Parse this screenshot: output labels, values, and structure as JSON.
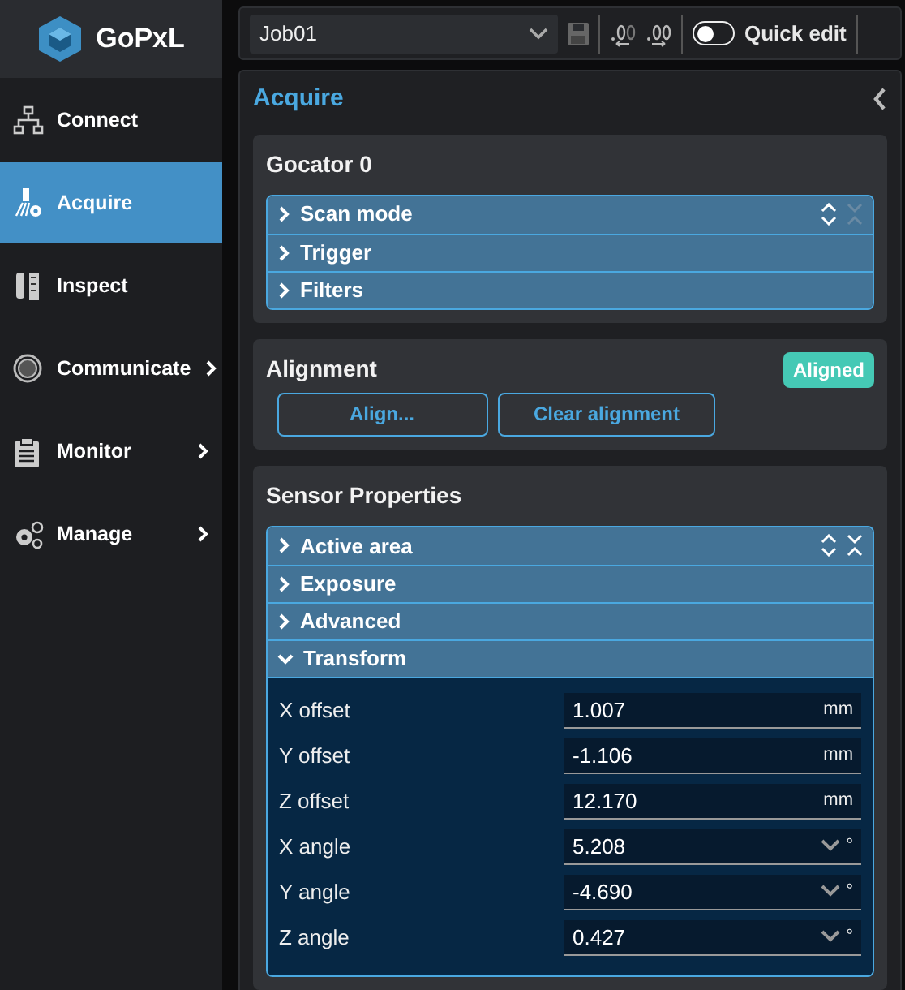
{
  "logo": {
    "text": "GoPxL"
  },
  "nav": [
    {
      "label": "Connect",
      "selected": false,
      "submenu": false
    },
    {
      "label": "Acquire",
      "selected": true,
      "submenu": false
    },
    {
      "label": "Inspect",
      "selected": false,
      "submenu": false
    },
    {
      "label": "Communicate",
      "selected": false,
      "submenu": true
    },
    {
      "label": "Monitor",
      "selected": false,
      "submenu": true
    },
    {
      "label": "Manage",
      "selected": false,
      "submenu": true
    }
  ],
  "toolbar": {
    "job": "Job01",
    "quick_edit": {
      "label": "Quick edit",
      "on": false
    }
  },
  "panel": {
    "title": "Acquire",
    "gocator": {
      "title": "Gocator 0",
      "collapse_all_disabled": true,
      "items": [
        {
          "label": "Scan mode",
          "expanded": false
        },
        {
          "label": "Trigger",
          "expanded": false
        },
        {
          "label": "Filters",
          "expanded": false
        }
      ]
    },
    "alignment": {
      "title": "Alignment",
      "status": "Aligned",
      "buttons": [
        "Align...",
        "Clear alignment"
      ]
    },
    "sensor": {
      "title": "Sensor Properties",
      "collapse_all_disabled": false,
      "items": [
        {
          "label": "Active area",
          "expanded": false
        },
        {
          "label": "Exposure",
          "expanded": false
        },
        {
          "label": "Advanced",
          "expanded": false
        },
        {
          "label": "Transform",
          "expanded": true
        }
      ],
      "transform": [
        {
          "label": "X offset",
          "value": "1.007",
          "unit": "mm",
          "kind": "number"
        },
        {
          "label": "Y offset",
          "value": "-1.106",
          "unit": "mm",
          "kind": "number"
        },
        {
          "label": "Z offset",
          "value": "12.170",
          "unit": "mm",
          "kind": "number"
        },
        {
          "label": "X angle",
          "value": "5.208",
          "unit": "°",
          "kind": "dropdown"
        },
        {
          "label": "Y angle",
          "value": "-4.690",
          "unit": "°",
          "kind": "dropdown"
        },
        {
          "label": "Z angle",
          "value": "0.427",
          "unit": "°",
          "kind": "dropdown"
        }
      ]
    }
  }
}
